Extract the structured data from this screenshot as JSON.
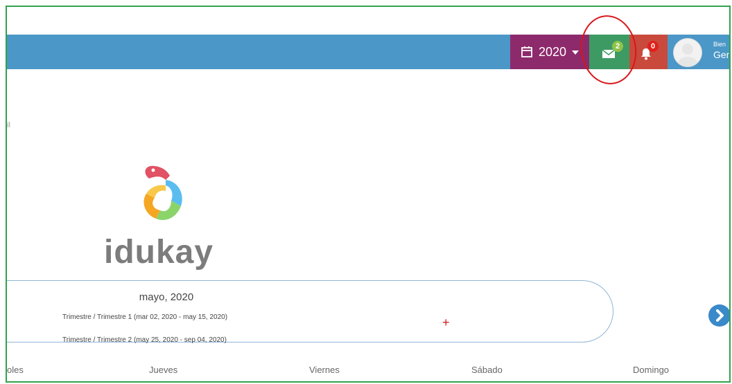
{
  "topbar": {
    "year": "2020",
    "messages_count": "2",
    "notifications_count": "0",
    "user_greeting": "Bien",
    "user_name": "Gen"
  },
  "breadcrumb_fragment": "il",
  "brand": {
    "name": "idukay"
  },
  "calendar": {
    "month_label": "mayo, 2020",
    "periods": [
      "Trimestre / Trimestre 1 (mar 02, 2020 - may 15, 2020)",
      "Trimestre / Trimestre 2 (may 25, 2020 - sep 04, 2020)"
    ],
    "add_label": "+",
    "weekdays": [
      "oles",
      "Jueves",
      "Viernes",
      "Sábado",
      "Domingo"
    ]
  },
  "colors": {
    "topbar": "#4b97c7",
    "year_button": "#8d2a6c",
    "messages_button": "#3e9a63",
    "notifications_button": "#c94a3c",
    "annotation_circle": "#d8161a"
  }
}
